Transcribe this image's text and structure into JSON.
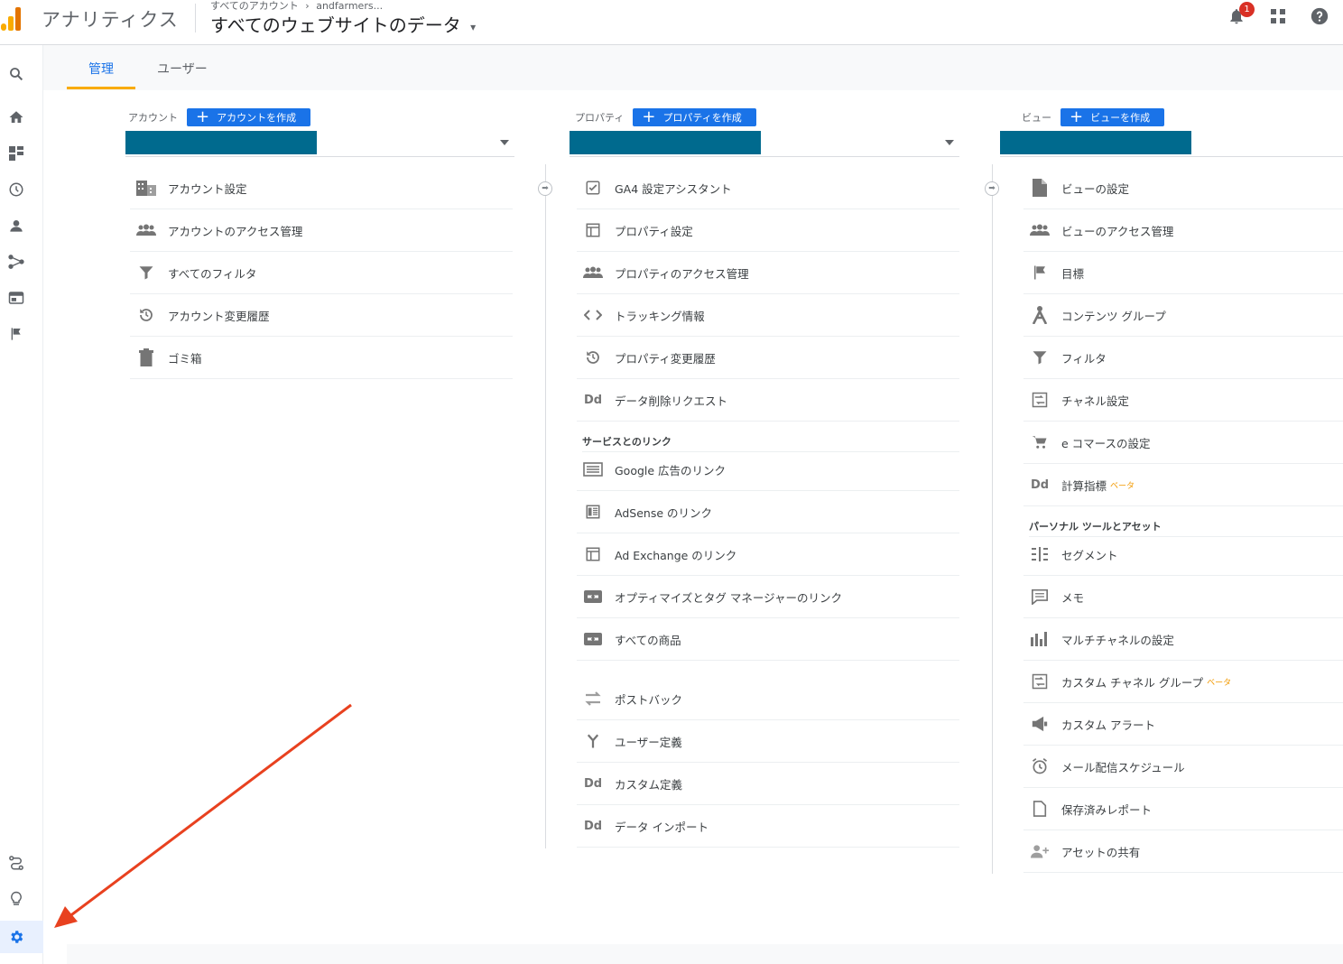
{
  "header": {
    "app_name": "アナリティクス",
    "breadcrumb_root": "すべてのアカウント",
    "breadcrumb_sep": "›",
    "breadcrumb_account": "andfarmers...",
    "scope_title": "すべてのウェブサイトのデータ",
    "notification_count": "1"
  },
  "tabs": [
    {
      "label": "管理"
    },
    {
      "label": "ユーザー"
    }
  ],
  "columns": {
    "account": {
      "label": "アカウント",
      "create_label": "アカウントを作成",
      "items": [
        {
          "label": "アカウント設定",
          "icon": "building-icon"
        },
        {
          "label": "アカウントのアクセス管理",
          "icon": "people-icon"
        },
        {
          "label": "すべてのフィルタ",
          "icon": "filter-icon"
        },
        {
          "label": "アカウント変更履歴",
          "icon": "history-icon"
        },
        {
          "label": "ゴミ箱",
          "icon": "trash-icon"
        }
      ]
    },
    "property": {
      "label": "プロパティ",
      "create_label": "プロパティを作成",
      "items": [
        {
          "label": "GA4 設定アシスタント",
          "icon": "checkbox-icon"
        },
        {
          "label": "プロパティ設定",
          "icon": "window-icon"
        },
        {
          "label": "プロパティのアクセス管理",
          "icon": "people-icon"
        },
        {
          "label": "トラッキング情報",
          "icon": "code-icon"
        },
        {
          "label": "プロパティ変更履歴",
          "icon": "history-icon"
        },
        {
          "label": "データ削除リクエスト",
          "icon": "dd-icon"
        }
      ],
      "section_label": "サービスとのリンク",
      "link_items": [
        {
          "label": "Google 広告のリンク",
          "icon": "ads-icon"
        },
        {
          "label": "AdSense のリンク",
          "icon": "adsense-icon"
        },
        {
          "label": "Ad Exchange のリンク",
          "icon": "window-icon"
        },
        {
          "label": "オプティマイズとタグ マネージャーのリンク",
          "icon": "link-icon"
        },
        {
          "label": "すべての商品",
          "icon": "link-icon"
        }
      ],
      "extra_items": [
        {
          "label": "ポストバック",
          "icon": "postback-icon"
        },
        {
          "label": "ユーザー定義",
          "icon": "fork-icon"
        },
        {
          "label": "カスタム定義",
          "icon": "dd-icon"
        },
        {
          "label": "データ インポート",
          "icon": "dd-icon"
        }
      ]
    },
    "view": {
      "label": "ビュー",
      "create_label": "ビューを作成",
      "items": [
        {
          "label": "ビューの設定",
          "icon": "document-icon"
        },
        {
          "label": "ビューのアクセス管理",
          "icon": "people-icon"
        },
        {
          "label": "目標",
          "icon": "flag-icon"
        },
        {
          "label": "コンテンツ グループ",
          "icon": "content-group-icon"
        },
        {
          "label": "フィルタ",
          "icon": "filter-icon"
        },
        {
          "label": "チャネル設定",
          "icon": "channel-icon"
        },
        {
          "label": "e コマースの設定",
          "icon": "cart-icon"
        },
        {
          "label": "計算指標",
          "icon": "dd-icon",
          "beta": "ベータ"
        }
      ],
      "section_label": "パーソナル ツールとアセット",
      "personal_items": [
        {
          "label": "セグメント",
          "icon": "segment-icon"
        },
        {
          "label": "メモ",
          "icon": "comment-icon"
        },
        {
          "label": "マルチチャネルの設定",
          "icon": "bars-icon"
        },
        {
          "label": "カスタム チャネル グループ",
          "icon": "channel-icon",
          "beta": "ベータ"
        },
        {
          "label": "カスタム アラート",
          "icon": "megaphone-icon"
        },
        {
          "label": "メール配信スケジュール",
          "icon": "alarm-icon"
        },
        {
          "label": "保存済みレポート",
          "icon": "page-icon"
        },
        {
          "label": "アセットの共有",
          "icon": "person-add-icon"
        }
      ]
    }
  },
  "colors": {
    "accent": "#1a73e8",
    "tab_underline": "#f9ab00",
    "selector_fill": "#006a8e",
    "annotation_arrow": "#e8411f"
  }
}
